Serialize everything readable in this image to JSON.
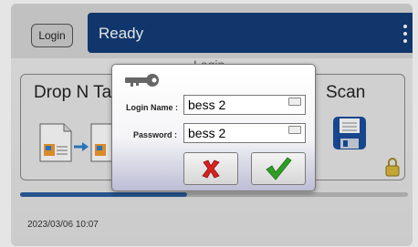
{
  "app": {
    "login_button": "Login",
    "status": "Ready",
    "panel_title": "Login",
    "tiles": {
      "left_label": "Drop N Tak",
      "right_label": "Scan"
    },
    "progress": 0.43,
    "timestamp": "2023/03/06 10:07"
  },
  "dialog": {
    "icon": "key-icon",
    "login_name_label": "Login Name :",
    "login_name_value": "bess 2",
    "password_label": "Password :",
    "password_value": "bess 2",
    "cancel_icon": "cross-icon",
    "confirm_icon": "checkmark-icon"
  },
  "colors": {
    "status_bar": "#123d78",
    "cancel": "#d92121",
    "confirm": "#2f9e24"
  }
}
